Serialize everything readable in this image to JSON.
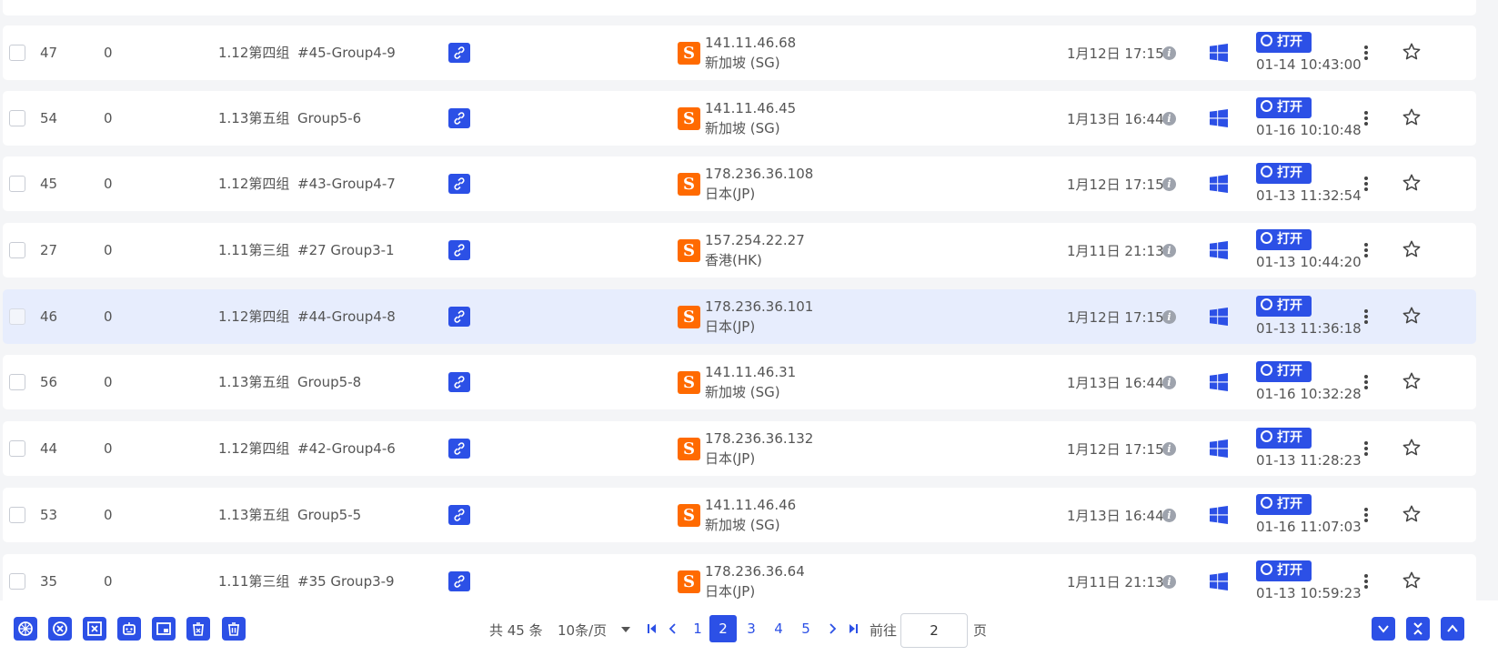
{
  "rows": [
    {
      "id": "47",
      "zero": "0",
      "group": "1.12第四组",
      "name": "#45-Group4-9",
      "ip": "141.11.46.68",
      "region": "新加坡 (SG)",
      "created": "1月12日 17:15",
      "open_label": "打开",
      "open_time": "01-14 10:43:00",
      "highlight": false
    },
    {
      "id": "54",
      "zero": "0",
      "group": "1.13第五组",
      "name": "Group5-6",
      "ip": "141.11.46.45",
      "region": "新加坡 (SG)",
      "created": "1月13日 16:44",
      "open_label": "打开",
      "open_time": "01-16 10:10:48",
      "highlight": false
    },
    {
      "id": "45",
      "zero": "0",
      "group": "1.12第四组",
      "name": "#43-Group4-7",
      "ip": "178.236.36.108",
      "region": "日本(JP)",
      "created": "1月12日 17:15",
      "open_label": "打开",
      "open_time": "01-13 11:32:54",
      "highlight": false
    },
    {
      "id": "27",
      "zero": "0",
      "group": "1.11第三组",
      "name": "#27 Group3-1",
      "ip": "157.254.22.27",
      "region": "香港(HK)",
      "created": "1月11日 21:13",
      "open_label": "打开",
      "open_time": "01-13 10:44:20",
      "highlight": false
    },
    {
      "id": "46",
      "zero": "0",
      "group": "1.12第四组",
      "name": "#44-Group4-8",
      "ip": "178.236.36.101",
      "region": "日本(JP)",
      "created": "1月12日 17:15",
      "open_label": "打开",
      "open_time": "01-13 11:36:18",
      "highlight": true
    },
    {
      "id": "56",
      "zero": "0",
      "group": "1.13第五组",
      "name": "Group5-8",
      "ip": "141.11.46.31",
      "region": "新加坡 (SG)",
      "created": "1月13日 16:44",
      "open_label": "打开",
      "open_time": "01-16 10:32:28",
      "highlight": false
    },
    {
      "id": "44",
      "zero": "0",
      "group": "1.12第四组",
      "name": "#42-Group4-6",
      "ip": "178.236.36.132",
      "region": "日本(JP)",
      "created": "1月12日 17:15",
      "open_label": "打开",
      "open_time": "01-13 11:28:23",
      "highlight": false
    },
    {
      "id": "53",
      "zero": "0",
      "group": "1.13第五组",
      "name": "Group5-5",
      "ip": "141.11.46.46",
      "region": "新加坡 (SG)",
      "created": "1月13日 16:44",
      "open_label": "打开",
      "open_time": "01-16 11:07:03",
      "highlight": false
    },
    {
      "id": "35",
      "zero": "0",
      "group": "1.11第三组",
      "name": "#35 Group3-9",
      "ip": "178.236.36.64",
      "region": "日本(JP)",
      "created": "1月11日 21:13",
      "open_label": "打开",
      "open_time": "01-13 10:59:23",
      "highlight": false
    }
  ],
  "row_icons": {
    "link": "link-icon",
    "proxy": "proxy-s-icon",
    "info": "info-icon",
    "os": "windows-icon",
    "open": "open-browser-icon",
    "more": "more-vertical-icon",
    "favorite": "star-icon"
  },
  "toolbar": {
    "icons": [
      "proxy-check-icon",
      "close-browser-icon",
      "clear-cache-icon",
      "automation-robot-icon",
      "window-arrange-icon",
      "recycle-bin-icon",
      "delete-icon"
    ]
  },
  "pagination": {
    "total": "共 45 条",
    "page_size": "10条/页",
    "pages": [
      "1",
      "2",
      "3",
      "4",
      "5"
    ],
    "current_page": "2",
    "goto_label": "前往",
    "goto_value": "2",
    "goto_suffix": "页"
  },
  "right_buttons": [
    "scroll-down-icon",
    "collapse-icon",
    "scroll-up-icon"
  ],
  "colors": {
    "accent": "#2c50e6",
    "proxy_badge": "#ff6a00",
    "highlight_row": "#e7edfd",
    "background": "#f4f5f7"
  }
}
